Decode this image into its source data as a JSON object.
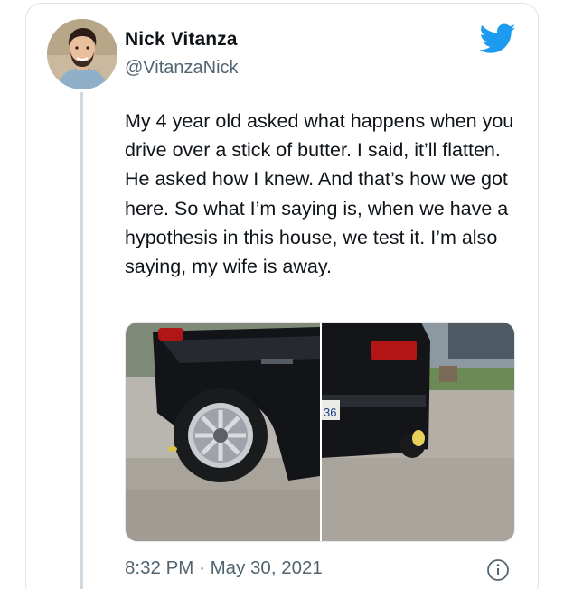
{
  "tweet": {
    "author_name": "Nick Vitanza",
    "author_handle": "@VitanzaNick",
    "text": "My 4 year old asked what happens when you drive over a stick of butter. I said, it’ll flatten. He asked how I knew. And that’s how we got here. So what I’m saying is, when we have a hypothesis in this house, we test it. I’m also saying, my wife is away.",
    "time": "8:32 PM",
    "separator": "·",
    "date": "May 30, 2021"
  },
  "media": {
    "right_plate_text": "36"
  },
  "icons": {
    "brand": "twitter-bird-icon",
    "info": "info-icon"
  },
  "colors": {
    "twitter_blue": "#1d9bf0",
    "muted_text": "#536471",
    "border": "#dfe3e6"
  }
}
